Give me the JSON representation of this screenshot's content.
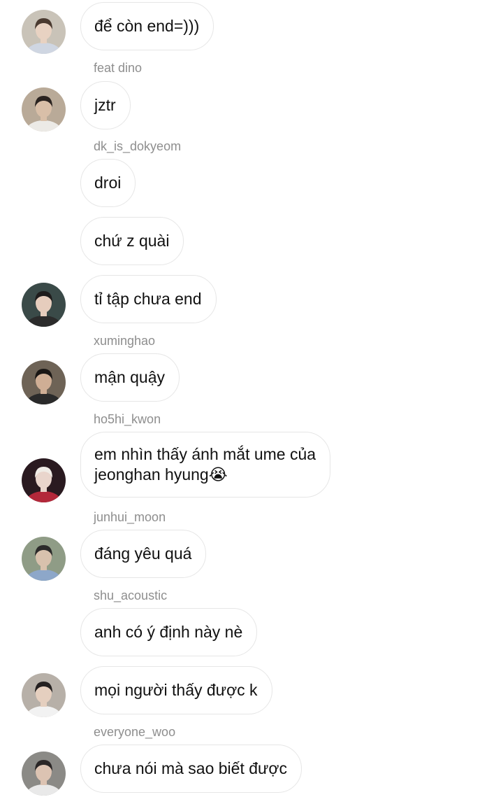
{
  "messages": [
    {
      "text": "để còn end=)))"
    },
    {
      "sender": "feat dino",
      "text": "jztr"
    },
    {
      "sender": "dk_is_dokyeom",
      "text": "droi"
    },
    {
      "text": "chứ z quài"
    },
    {
      "text": "tỉ tập chưa end"
    },
    {
      "sender": "xuminghao",
      "text": "mận quậy"
    },
    {
      "sender": "ho5hi_kwon",
      "line1": "em nhìn thấy ánh mắt ume của",
      "line2": "jeonghan hyung😭"
    },
    {
      "sender": "junhui_moon",
      "text": "đáng yêu quá"
    },
    {
      "sender": "shu_acoustic",
      "text": "anh có ý định này nè"
    },
    {
      "text": "mọi người thấy được k"
    },
    {
      "sender": "everyone_woo",
      "text": "chưa nói mà sao biết được"
    }
  ],
  "avatars": [
    {
      "icon": "avatar-photo-icon",
      "bg": "#c9c3b8",
      "hair": "#4a3a30",
      "skin": "#e8d2c2",
      "shirt": "#cfd6e2"
    },
    {
      "icon": "avatar-photo-icon",
      "bg": "#b9aa98",
      "hair": "#2a2320",
      "skin": "#d9bfa8",
      "shirt": "#eceae6"
    },
    {
      "icon": "avatar-photo-icon",
      "bg": "#3a4a48",
      "hair": "#1e1c1c",
      "skin": "#e6cdbd",
      "shirt": "#2b2b2b"
    },
    {
      "icon": "avatar-photo-icon",
      "bg": "#6e6356",
      "hair": "#1a1715",
      "skin": "#cfae95",
      "shirt": "#2a2a2a"
    },
    {
      "icon": "avatar-photo-icon",
      "bg": "#2a1a20",
      "hair": "#f0ece6",
      "skin": "#e9d5cc",
      "shirt": "#b3283a"
    },
    {
      "icon": "avatar-photo-icon",
      "bg": "#8f9c86",
      "hair": "#2b2a2a",
      "skin": "#d8c1ad",
      "shirt": "#8da7c9"
    },
    {
      "icon": "avatar-photo-icon",
      "bg": "#b7b0a8",
      "hair": "#242020",
      "skin": "#e5cfbf",
      "shirt": "#f2f2f2"
    },
    {
      "icon": "avatar-photo-icon",
      "bg": "#8b8a86",
      "hair": "#2a2626",
      "skin": "#dcc3b2",
      "shirt": "#e9e9e9"
    }
  ],
  "colors": {
    "bubble_border": "#e6e6e6",
    "sender": "#8e8e8e",
    "text": "#111111"
  }
}
